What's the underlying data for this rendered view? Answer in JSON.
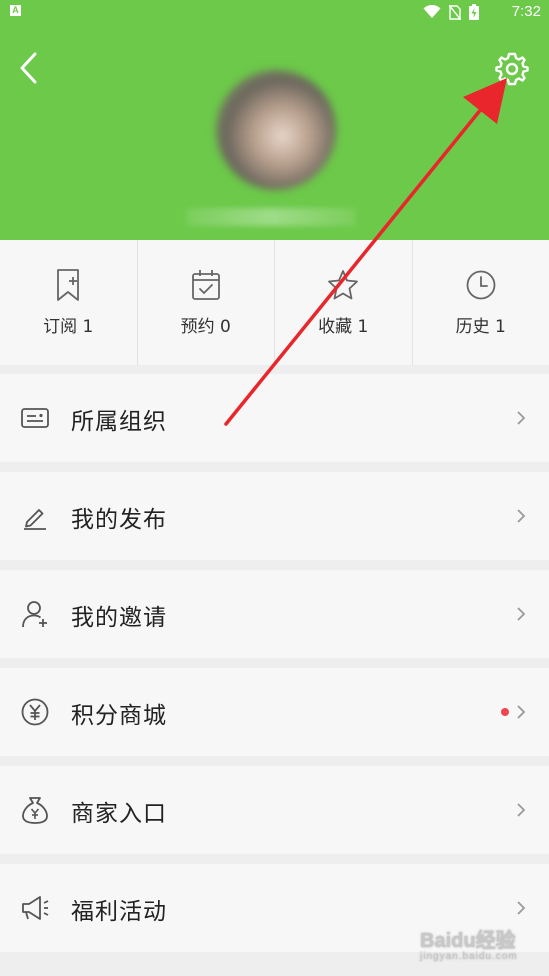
{
  "status_bar": {
    "app_badge": "A",
    "time": "7:32",
    "battery": "battery-icon",
    "wifi": "wifi-icon",
    "signal": "no-sim-icon"
  },
  "header": {
    "back_icon": "chevron-left-icon",
    "settings_icon": "gear-icon",
    "accent_color": "#6cc949"
  },
  "stats": [
    {
      "label": "订阅",
      "count": "1",
      "icon": "bookmark-add-icon"
    },
    {
      "label": "预约",
      "count": "0",
      "icon": "calendar-check-icon"
    },
    {
      "label": "收藏",
      "count": "1",
      "icon": "star-icon"
    },
    {
      "label": "历史",
      "count": "1",
      "icon": "clock-icon"
    }
  ],
  "menu": [
    {
      "label": "所属组织",
      "icon": "id-card-icon",
      "badge": false
    },
    {
      "label": "我的发布",
      "icon": "pencil-icon",
      "badge": false
    },
    {
      "label": "我的邀请",
      "icon": "user-add-icon",
      "badge": false
    },
    {
      "label": "积分商城",
      "icon": "yen-coin-icon",
      "badge": true
    },
    {
      "label": "商家入口",
      "icon": "money-bag-icon",
      "badge": false
    },
    {
      "label": "福利活动",
      "icon": "megaphone-icon",
      "badge": false
    }
  ],
  "annotation": {
    "arrow_color": "#e8262b"
  },
  "watermark": {
    "brand": "Bai",
    "paw": "du",
    "suffix": "经验",
    "site": "jingyan.baidu.com"
  }
}
